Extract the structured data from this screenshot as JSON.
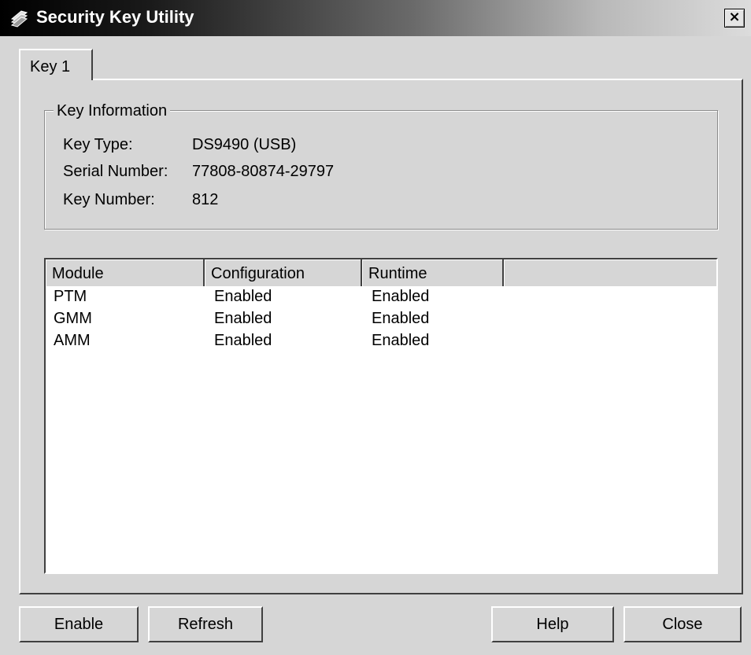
{
  "window": {
    "title": "Security Key Utility",
    "close_glyph": "×"
  },
  "tabs": [
    {
      "label": "Key 1",
      "selected": true
    }
  ],
  "key_information": {
    "legend": "Key Information",
    "fields": [
      {
        "label": "Key Type:",
        "value": "DS9490 (USB)"
      },
      {
        "label": "Serial Number:",
        "value": "77808-80874-29797"
      },
      {
        "label": "Key Number:",
        "value": "812"
      }
    ]
  },
  "modules_table": {
    "columns": [
      "Module",
      "Configuration",
      "Runtime",
      ""
    ],
    "rows": [
      [
        "PTM",
        "Enabled",
        "Enabled"
      ],
      [
        "GMM",
        "Enabled",
        "Enabled"
      ],
      [
        "AMM",
        "Enabled",
        "Enabled"
      ]
    ]
  },
  "buttons": {
    "enable": "Enable",
    "refresh": "Refresh",
    "help": "Help",
    "close": "Close"
  },
  "icons": {
    "app": "key-icon",
    "close": "close-icon"
  }
}
